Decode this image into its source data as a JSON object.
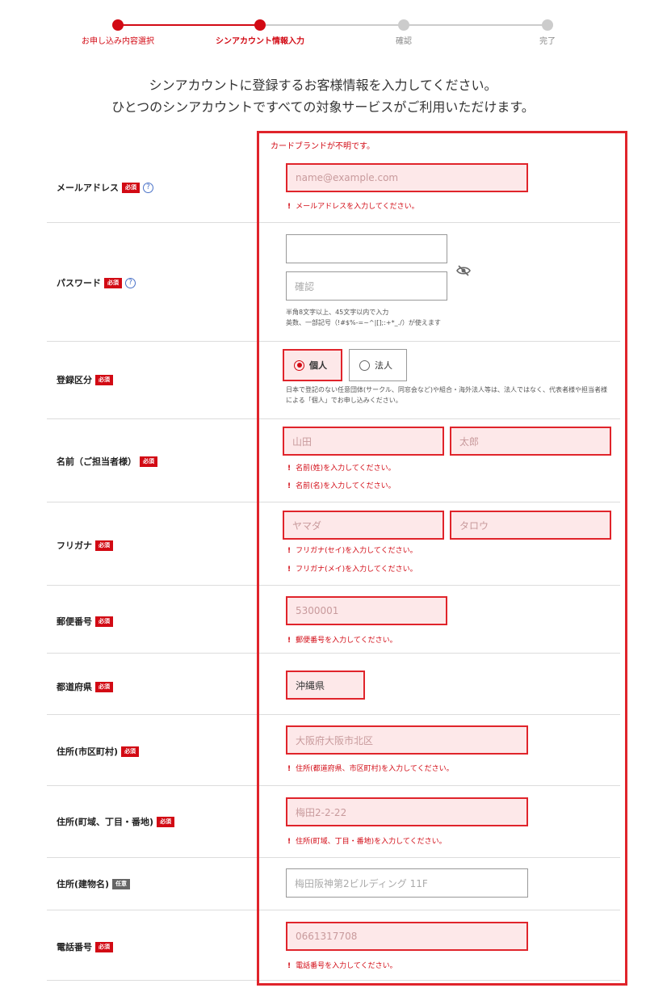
{
  "stepper": {
    "steps": [
      {
        "label": "お申し込み内容選択"
      },
      {
        "label": "シンアカウント情報入力"
      },
      {
        "label": "確認"
      },
      {
        "label": "完了"
      }
    ]
  },
  "intro": {
    "line1": "シンアカウントに登録するお客様情報を入力してください。",
    "line2": "ひとつのシンアカウントですべての対象サービスがご利用いただけます。"
  },
  "top_error": "カードブランドが不明です。",
  "badges": {
    "required": "必須",
    "optional": "任意"
  },
  "help_mark": "?",
  "error_mark": "!",
  "email": {
    "label": "メールアドレス",
    "placeholder": "name@example.com",
    "error": "メールアドレスを入力してください。"
  },
  "password": {
    "label": "パスワード",
    "value": "",
    "confirm_placeholder": "確認",
    "note1": "半角8文字以上、45文字以内で入力",
    "note2": "英数、一部記号（!#$%-=~^|[];:+*_./）が使えます"
  },
  "registration_type": {
    "label": "登録区分",
    "options": [
      {
        "label": "個人",
        "selected": true
      },
      {
        "label": "法人",
        "selected": false
      }
    ],
    "note1": "日本で登記のない任意団体(サークル、同窓会など)や組合・海外法人等は、法人ではなく、代表者様や担当者様による「個人」でお申し込みください。"
  },
  "name": {
    "label": "名前（ご担当者様）",
    "last_placeholder": "山田",
    "first_placeholder": "太郎",
    "error_last": "名前(姓)を入力してください。",
    "error_first": "名前(名)を入力してください。"
  },
  "furigana": {
    "label": "フリガナ",
    "last_placeholder": "ヤマダ",
    "first_placeholder": "タロウ",
    "error_last": "フリガナ(セイ)を入力してください。",
    "error_first": "フリガナ(メイ)を入力してください。"
  },
  "postal_code": {
    "label": "郵便番号",
    "placeholder": "5300001",
    "error": "郵便番号を入力してください。"
  },
  "prefecture": {
    "label": "都道府県",
    "value": "沖縄県"
  },
  "city": {
    "label": "住所(市区町村)",
    "placeholder": "大阪府大阪市北区",
    "error": "住所(都道府県、市区町村)を入力してください。"
  },
  "street": {
    "label": "住所(町域、丁目・番地)",
    "placeholder": "梅田2-2-22",
    "error": "住所(町域、丁目・番地)を入力してください。"
  },
  "building": {
    "label": "住所(建物名)",
    "placeholder": "梅田阪神第2ビルディング 11F"
  },
  "phone": {
    "label": "電話番号",
    "placeholder": "0661317708",
    "error": "電話番号を入力してください。"
  },
  "colors": {
    "accent": "#d20a14",
    "error_bg": "#fde8e9",
    "frame": "#e0242b"
  }
}
